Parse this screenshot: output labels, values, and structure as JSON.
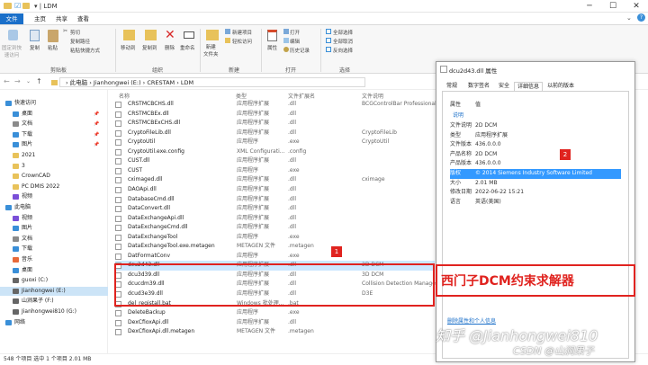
{
  "window": {
    "title": "LDM",
    "qa": "▾ | LDM"
  },
  "tabs": [
    "文件",
    "主页",
    "共享",
    "查看"
  ],
  "ribbon": {
    "groups": [
      "剪贴板",
      "组织",
      "新建",
      "打开",
      "选择"
    ],
    "pin": "固定到快\n速访问",
    "copy": "复制",
    "paste": "粘贴",
    "cut": "剪切",
    "copy_path": "复制路径",
    "paste_shortcut": "粘贴快捷方式",
    "move_to": "移动到",
    "copy_to": "复制到",
    "delete": "删除",
    "rename": "重命名",
    "new_folder": "新建\n文件夹",
    "new_item": "新建项目",
    "easy_access": "轻松访问",
    "properties": "属性",
    "open": "打开",
    "edit": "编辑",
    "history": "历史记录",
    "select_all": "全部选择",
    "select_none": "全部取消",
    "invert": "反向选择"
  },
  "address": {
    "path": "›  此电脑  ›  Jianhongwei (E:)  ›  CRESTAM  ›  LDM"
  },
  "nav": [
    {
      "label": "快速访问",
      "pin": false,
      "color": "#3a8fd8",
      "indent": 0
    },
    {
      "label": "桌面",
      "pin": true,
      "color": "#3a8fd8",
      "indent": 1
    },
    {
      "label": "文档",
      "pin": true,
      "color": "#8a8a8a",
      "indent": 1
    },
    {
      "label": "下载",
      "pin": true,
      "color": "#3a8fd8",
      "indent": 1
    },
    {
      "label": "图片",
      "pin": true,
      "color": "#3a8fd8",
      "indent": 1
    },
    {
      "label": "2021",
      "pin": false,
      "color": "#e8c25a",
      "indent": 1
    },
    {
      "label": "3",
      "pin": false,
      "color": "#e8c25a",
      "indent": 1
    },
    {
      "label": "CrownCAD",
      "pin": false,
      "color": "#e8c25a",
      "indent": 1
    },
    {
      "label": "PC DMIS 2022",
      "pin": false,
      "color": "#e8c25a",
      "indent": 1
    },
    {
      "label": "视频",
      "pin": false,
      "color": "#7a4fd8",
      "indent": 1
    },
    {
      "label": "此电脑",
      "pin": false,
      "color": "#3a8fd8",
      "indent": 0
    },
    {
      "label": "视频",
      "pin": false,
      "color": "#7a4fd8",
      "indent": 1
    },
    {
      "label": "图片",
      "pin": false,
      "color": "#3a8fd8",
      "indent": 1
    },
    {
      "label": "文档",
      "pin": false,
      "color": "#8a8a8a",
      "indent": 1
    },
    {
      "label": "下载",
      "pin": false,
      "color": "#3a8fd8",
      "indent": 1
    },
    {
      "label": "音乐",
      "pin": false,
      "color": "#e86a3a",
      "indent": 1
    },
    {
      "label": "桌面",
      "pin": false,
      "color": "#3a8fd8",
      "indent": 1
    },
    {
      "label": "guoxi (C:)",
      "pin": false,
      "color": "#666",
      "indent": 1
    },
    {
      "label": "Jianhongwei (E:)",
      "pin": false,
      "color": "#666",
      "indent": 1,
      "selected": true
    },
    {
      "label": "山涧果子 (F:)",
      "pin": false,
      "color": "#666",
      "indent": 1
    },
    {
      "label": "Jianhongwei810 (G:)",
      "pin": false,
      "color": "#666",
      "indent": 1
    },
    {
      "label": "网络",
      "pin": false,
      "color": "#3a8fd8",
      "indent": 0
    }
  ],
  "columns": [
    "名称",
    "类型",
    "文件扩展名",
    "文件说明"
  ],
  "files": [
    {
      "name": "CRSTMCBCHS.dll",
      "type": "应用程序扩展",
      "ext": ".dll",
      "desc": "BCGControlBar Professional"
    },
    {
      "name": "CRSTMCBEx.dll",
      "type": "应用程序扩展",
      "ext": ".dll",
      "desc": ""
    },
    {
      "name": "CRSTMCBExCHS.dll",
      "type": "应用程序扩展",
      "ext": ".dll",
      "desc": ""
    },
    {
      "name": "CryptoFileLib.dll",
      "type": "应用程序扩展",
      "ext": ".dll",
      "desc": "CryptoFileLib"
    },
    {
      "name": "CryptoUtil",
      "type": "应用程序",
      "ext": ".exe",
      "desc": "CryptoUtil"
    },
    {
      "name": "CryptoUtil.exe.config",
      "type": "XML Configurati...",
      "ext": ".config",
      "desc": ""
    },
    {
      "name": "CUST.dll",
      "type": "应用程序扩展",
      "ext": ".dll",
      "desc": ""
    },
    {
      "name": "CUST",
      "type": "应用程序",
      "ext": ".exe",
      "desc": ""
    },
    {
      "name": "cximaged.dll",
      "type": "应用程序扩展",
      "ext": ".dll",
      "desc": "cximage"
    },
    {
      "name": "DAOApi.dll",
      "type": "应用程序扩展",
      "ext": ".dll",
      "desc": ""
    },
    {
      "name": "DatabaseCmd.dll",
      "type": "应用程序扩展",
      "ext": ".dll",
      "desc": ""
    },
    {
      "name": "DataConvert.dll",
      "type": "应用程序扩展",
      "ext": ".dll",
      "desc": ""
    },
    {
      "name": "DataExchangeApi.dll",
      "type": "应用程序扩展",
      "ext": ".dll",
      "desc": ""
    },
    {
      "name": "DataExchangeCmd.dll",
      "type": "应用程序扩展",
      "ext": ".dll",
      "desc": ""
    },
    {
      "name": "DataExchangeTool",
      "type": "应用程序",
      "ext": ".exe",
      "desc": ""
    },
    {
      "name": "DataExchangeTool.exe.metagen",
      "type": "METAGEN 文件",
      "ext": ".metagen",
      "desc": ""
    },
    {
      "name": "DatFormatConv",
      "type": "应用程序",
      "ext": ".exe",
      "desc": ""
    },
    {
      "name": "dcu2d43.dll",
      "type": "应用程序扩展",
      "ext": ".dll",
      "desc": "2D DCM",
      "sel": true
    },
    {
      "name": "dcu3d39.dll",
      "type": "应用程序扩展",
      "ext": ".dll",
      "desc": "3D DCM"
    },
    {
      "name": "dcucdm39.dll",
      "type": "应用程序扩展",
      "ext": ".dll",
      "desc": "Collision Detection Manager"
    },
    {
      "name": "dcud3e39.dll",
      "type": "应用程序扩展",
      "ext": ".dll",
      "desc": "D3E"
    },
    {
      "name": "del_registall.bat",
      "type": "Windows 批处理...",
      "ext": ".bat",
      "desc": ""
    },
    {
      "name": "DeleteBackup",
      "type": "应用程序",
      "ext": ".exe",
      "desc": ""
    },
    {
      "name": "DexCfioxApi.dll",
      "type": "应用程序扩展",
      "ext": ".dll",
      "desc": ""
    },
    {
      "name": "DexCfioxApi.dll.metagen",
      "type": "METAGEN 文件",
      "ext": ".metagen",
      "desc": ""
    }
  ],
  "status": "548 个项目    选中 1 个项目  2.01 MB",
  "props": {
    "title": "dcu2d43.dll 属性",
    "tabs": [
      "常规",
      "数字签名",
      "安全",
      "详细信息",
      "以前的版本"
    ],
    "active_tab": "详细信息",
    "head_k": "属性",
    "head_v": "值",
    "section": "说明",
    "rows": [
      {
        "k": "文件说明",
        "v": "2D DCM"
      },
      {
        "k": "类型",
        "v": "应用程序扩展"
      },
      {
        "k": "文件版本",
        "v": "436.0.0.0"
      },
      {
        "k": "产品名称",
        "v": "2D DCM"
      },
      {
        "k": "产品版本",
        "v": "436.0.0.0"
      },
      {
        "k": "版权",
        "v": "© 2014 Siemens Industry Software Limited",
        "hl": true
      },
      {
        "k": "大小",
        "v": "2.01 MB"
      },
      {
        "k": "修改日期",
        "v": "2022-06-22 15:21"
      },
      {
        "k": "语言",
        "v": "英语(美国)"
      }
    ],
    "link": "删除属性和个人信息"
  },
  "annotations": {
    "n1": "1",
    "n2": "2",
    "caption": "西门子DCM约束求解器"
  },
  "watermark": "知乎 @Jianhongwei810",
  "watermark2": "CSDN @山涧果子"
}
